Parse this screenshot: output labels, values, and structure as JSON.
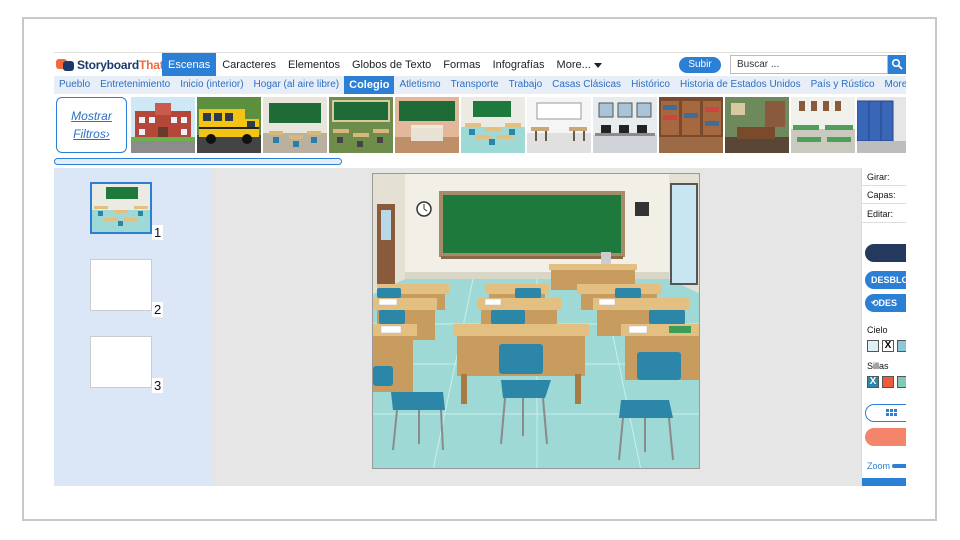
{
  "logo": {
    "part1": "Storyboard",
    "part2": "That"
  },
  "nav": {
    "items": [
      "Escenas",
      "Caracteres",
      "Elementos",
      "Globos de Texto",
      "Formas",
      "Infografías"
    ],
    "more": "More...",
    "upload": "Subir",
    "search_placeholder": "Buscar ..."
  },
  "categories": [
    "Pueblo",
    "Entretenimiento",
    "Inicio (interior)",
    "Hogar (al aire libre)",
    "Colegio",
    "Atletismo",
    "Transporte",
    "Trabajo",
    "Casas Clásicas",
    "Histórico",
    "Historia de Estados Unidos",
    "País y Rústico",
    "More..."
  ],
  "active_category": "Colegio",
  "filters": {
    "line1": "Mostrar",
    "line2": "Filtros›"
  },
  "thumbnails": [
    "school-exterior",
    "school-bus",
    "classroom-chalkboard",
    "outdoor-classroom",
    "teacher-desk",
    "classroom-desks",
    "art-room",
    "computer-lab",
    "library",
    "principal-office",
    "cafeteria",
    "lockers"
  ],
  "cells": [
    {
      "number": "1"
    },
    {
      "number": "2"
    },
    {
      "number": "3"
    }
  ],
  "right_panel": {
    "rotate": "Girar:",
    "layers": "Capas:",
    "edit": "Editar:",
    "unlock": "DESBLOQ",
    "undo": "DES",
    "sky": "Cielo",
    "chairs": "Sillas",
    "zoom": "Zoom"
  },
  "colors": {
    "accent": "#2b7fd4",
    "brand_navy": "#1b3a6b",
    "brand_orange": "#f26a3d",
    "wall": "#f1efe6",
    "chalkboard": "#1e7a3c",
    "floor": "#9ed9d6",
    "desk": "#e3bf82",
    "chair": "#2b86a8"
  }
}
